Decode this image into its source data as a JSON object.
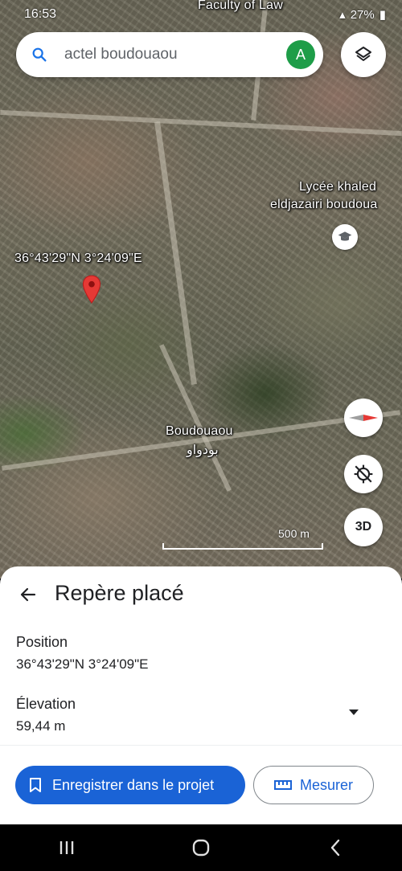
{
  "status_bar": {
    "time": "16:53",
    "battery": "27%"
  },
  "search": {
    "query": "actel boudouaou",
    "avatar_letter": "A"
  },
  "map": {
    "coordinates_label": "36°43'29\"N 3°24'09\"E",
    "place_labels": {
      "faculty": "Faculty of Law",
      "school_line1": "Lycée khaled",
      "school_line2": "eldjazairi boudoua",
      "town_latin": "Boudouaou",
      "town_arabic": "بودواو"
    },
    "scale": "500 m",
    "three_d_label": "3D"
  },
  "sheet": {
    "title": "Repère placé",
    "position_label": "Position",
    "position_value": "36°43'29\"N 3°24'09\"E",
    "elevation_label": "Élevation",
    "elevation_value": "59,44 m",
    "save_button": "Enregistrer dans le projet",
    "measure_button": "Mesurer"
  },
  "colors": {
    "primary": "#1a63d6",
    "avatar": "#1e9d48",
    "pin": "#e53935"
  }
}
